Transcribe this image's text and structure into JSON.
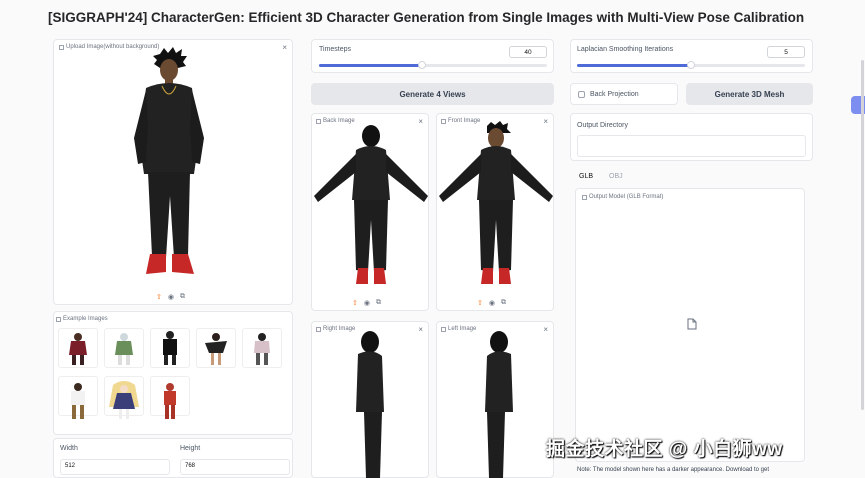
{
  "title": "[SIGGRAPH'24] CharacterGen: Efficient 3D Character Generation from Single Images with Multi-View Pose Calibration",
  "upload": {
    "label": "Upload Image(without background)",
    "close": "×"
  },
  "examples": {
    "label": "Example Images"
  },
  "width": {
    "label": "Width",
    "value": "512"
  },
  "height": {
    "label": "Height",
    "value": "768"
  },
  "timesteps": {
    "label": "Timesteps",
    "value": "40",
    "fraction": 0.45
  },
  "generate_views": "Generate 4 Views",
  "views": {
    "back": "Back Image",
    "front": "Front Image",
    "right": "Right Image",
    "left": "Left Image"
  },
  "laplacian": {
    "label": "Laplacian Smoothing Iterations",
    "value": "5",
    "fraction": 0.5
  },
  "back_projection": "Back Projection",
  "generate_mesh": "Generate 3D Mesh",
  "output_dir": {
    "label": "Output Directory",
    "value": ""
  },
  "tabs": [
    "GLB",
    "OBJ"
  ],
  "output_model": "Output Model (GLB Format)",
  "note": "Note: The model shown here has a darker appearance. Download to get",
  "watermark": "掘金技术社区 @ 小白狮ww",
  "icons": [
    "image-icon",
    "close-icon",
    "upload-icon",
    "webcam-icon",
    "paste-icon",
    "file-icon"
  ],
  "colors": {
    "accent": "#4f6bd8",
    "upload": "#f97316",
    "extension": "#7c8ef0"
  }
}
